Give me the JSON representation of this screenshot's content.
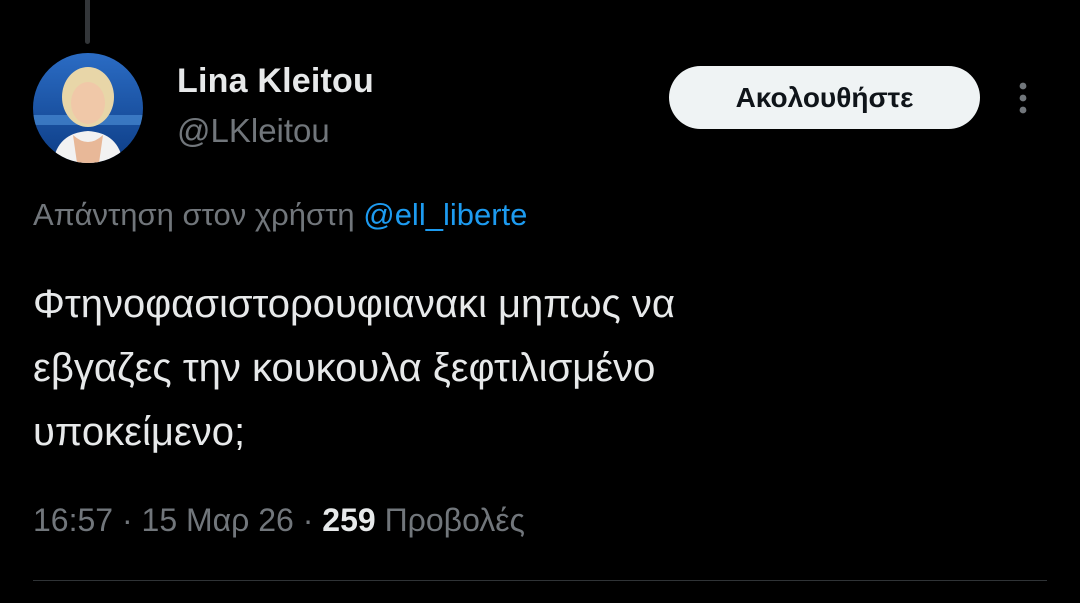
{
  "tweet": {
    "author": {
      "display_name": "Lina Kleitou",
      "handle": "@LKleitou"
    },
    "follow_button_label": "Ακολουθήστε",
    "reply_context": {
      "prefix": "Απάντηση στον χρήστη",
      "mention": "@ell_liberte"
    },
    "text": "Φτηνοφασιστορουφιανακι μηπως να\nεβγαζες την κουκουλα ξεφτιλισμένο\nυποκείμενο;",
    "meta": {
      "time": "16:57",
      "separator": "·",
      "date": "15 Μαρ 26",
      "views_count": "259",
      "views_label": "Προβολές"
    }
  },
  "icons": {
    "more": "more-vertical-icon"
  },
  "colors": {
    "background": "#000000",
    "primary_text": "#e7e9ea",
    "secondary_text": "#71767b",
    "link": "#1d9bf0",
    "follow_button_bg": "#eff3f4",
    "divider": "#2f3336"
  }
}
